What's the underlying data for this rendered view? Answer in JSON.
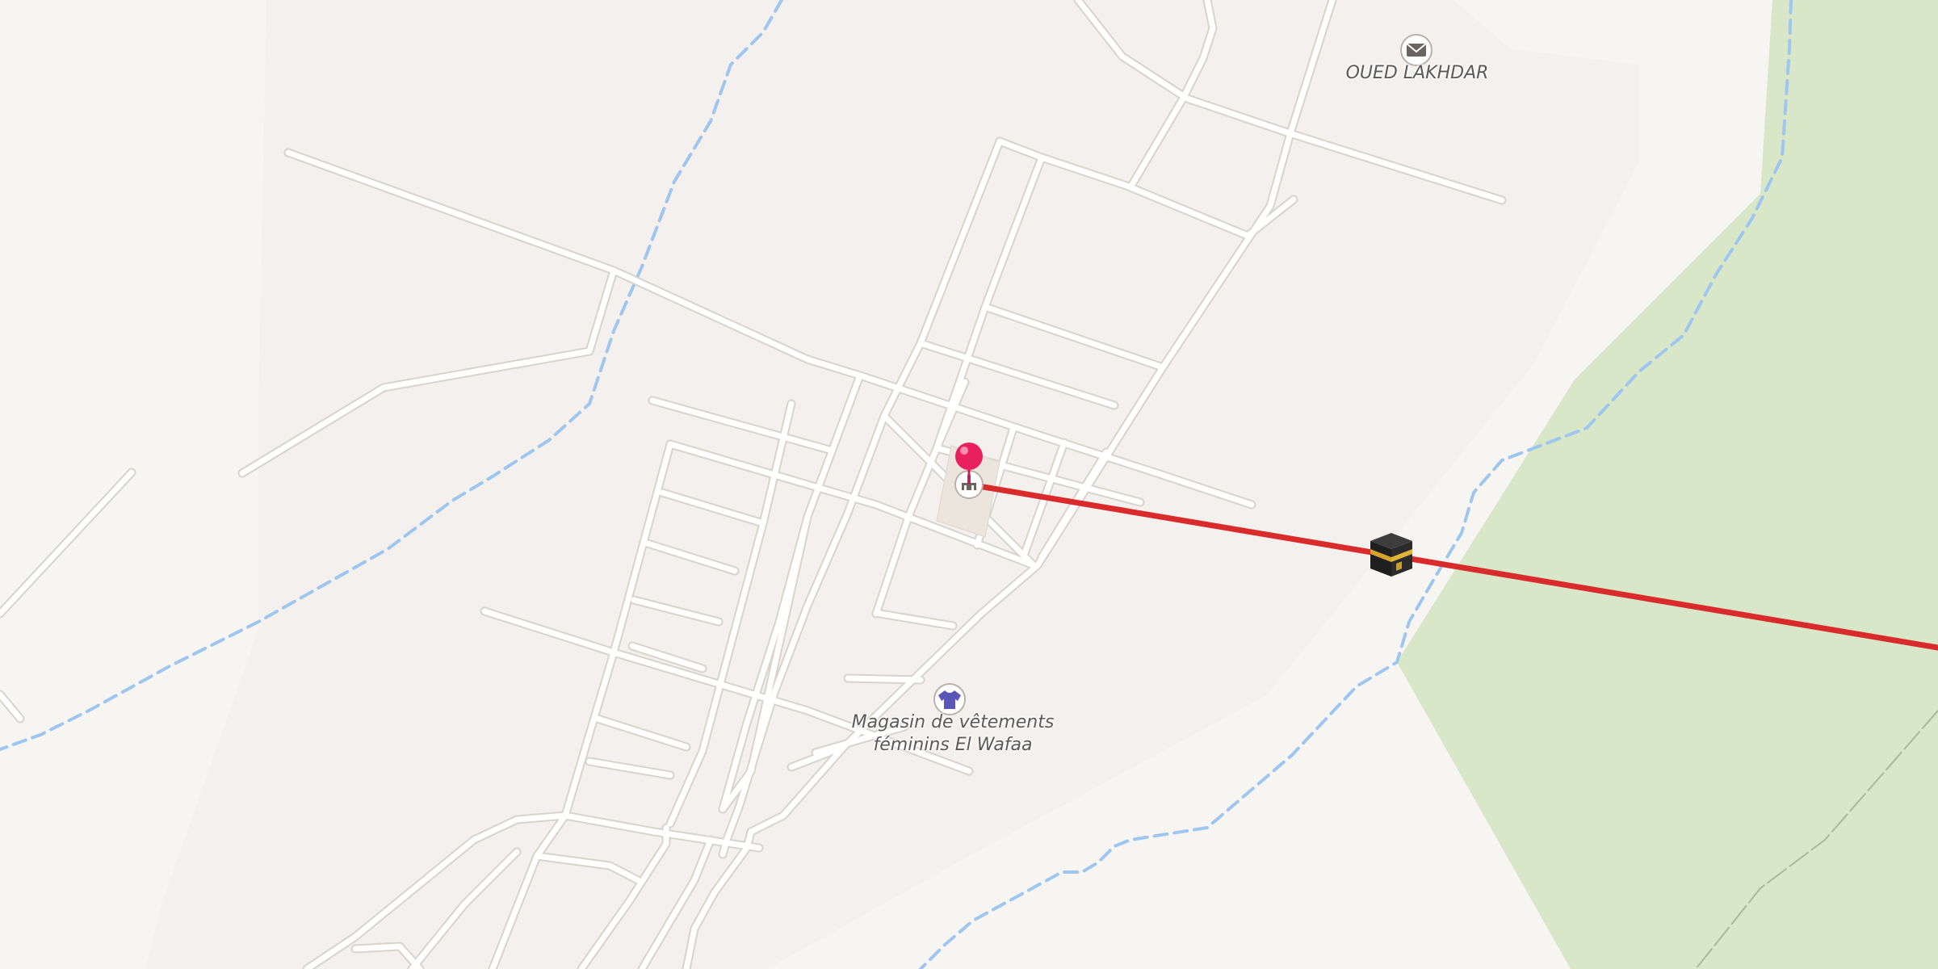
{
  "map": {
    "colors": {
      "land": "#f6f3ef",
      "residential": "#efebe7",
      "forest": "#d8e8c8",
      "road": "#ffffff",
      "road_casing": "#d8d3cc",
      "stream": "#9fc6ef",
      "route_line": "#d92b2b",
      "pin": "#e8215e"
    },
    "places": {
      "village": {
        "name": "OUED LAKHDAR",
        "icon": "post-office-icon"
      },
      "shop": {
        "name_line1": "Magasin de vêtements",
        "name_line2": "féminins El Wafaa",
        "icon": "clothes-shop-icon"
      }
    },
    "markers": {
      "origin": {
        "icon": "map-pin-icon"
      },
      "mosque": {
        "icon": "mosque-icon"
      },
      "destination": {
        "icon": "kaaba-icon"
      }
    },
    "route": {
      "type": "qibla-direction-line"
    }
  }
}
